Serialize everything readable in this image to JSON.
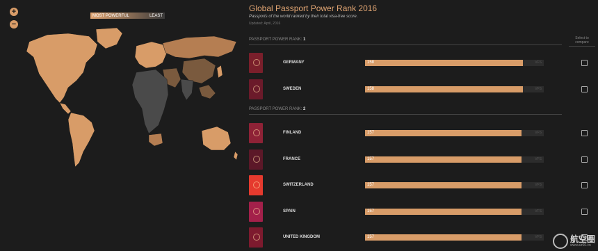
{
  "map_controls": {
    "zoom_in": "+",
    "zoom_out": "−"
  },
  "legend": {
    "most": "MOST POWERFUL",
    "least": "LEAST"
  },
  "header": {
    "title": "Global Passport Power Rank 2016",
    "subtitle": "Passports of the world ranked by their total visa-free score.",
    "updated": "Updated: April, 2016"
  },
  "compare_header": "Select to compare",
  "rank_label": "PASSPORT POWER RANK:",
  "ranks": [
    {
      "number": "1",
      "countries": [
        {
          "name": "GERMANY",
          "score": "158",
          "vfs": "VFS",
          "fraction": 0.883,
          "color": "#7a1f2b"
        },
        {
          "name": "SWEDEN",
          "score": "158",
          "vfs": "VFS",
          "fraction": 0.883,
          "color": "#6b1a2a"
        }
      ]
    },
    {
      "number": "2",
      "countries": [
        {
          "name": "FINLAND",
          "score": "157",
          "vfs": "VFS",
          "fraction": 0.877,
          "color": "#8e2236"
        },
        {
          "name": "FRANCE",
          "score": "157",
          "vfs": "VFS",
          "fraction": 0.877,
          "color": "#5c1828"
        },
        {
          "name": "SWITZERLAND",
          "score": "157",
          "vfs": "VFS",
          "fraction": 0.877,
          "color": "#e53a2e"
        },
        {
          "name": "SPAIN",
          "score": "157",
          "vfs": "VFS",
          "fraction": 0.877,
          "color": "#a3204a"
        },
        {
          "name": "UNITED KINGDOM",
          "score": "157",
          "vfs": "VFS",
          "fraction": 0.877,
          "color": "#7d1a2e"
        }
      ]
    }
  ],
  "watermark": {
    "text": "航空圈",
    "url": "www.air66.cn"
  }
}
